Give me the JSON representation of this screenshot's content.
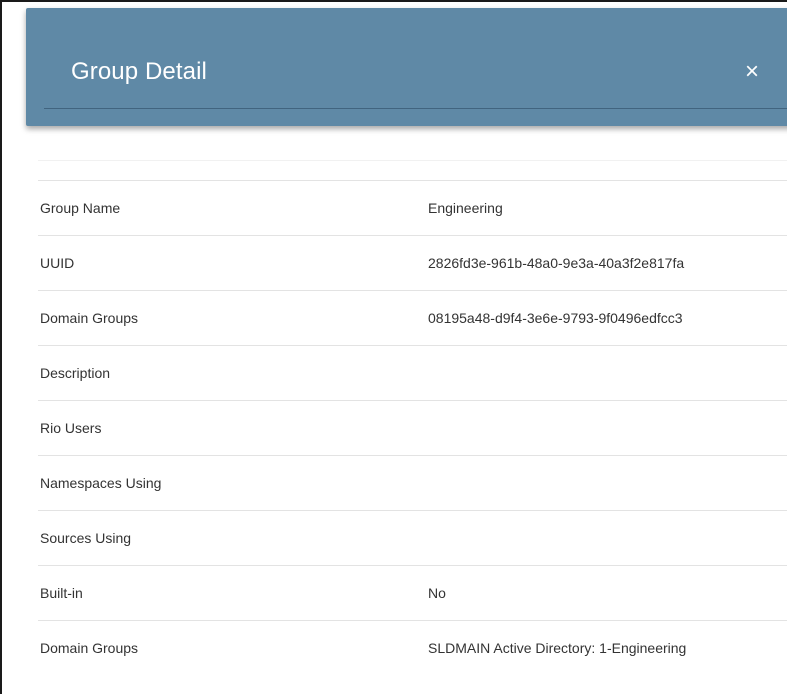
{
  "dialog": {
    "title": "Group Detail",
    "close_icon": "×"
  },
  "details": {
    "rows": [
      {
        "label": "Group Name",
        "value": "Engineering"
      },
      {
        "label": "UUID",
        "value": "2826fd3e-961b-48a0-9e3a-40a3f2e817fa"
      },
      {
        "label": "Domain Groups",
        "value": "08195a48-d9f4-3e6e-9793-9f0496edfcc3"
      },
      {
        "label": "Description",
        "value": ""
      },
      {
        "label": "Rio Users",
        "value": ""
      },
      {
        "label": "Namespaces Using",
        "value": ""
      },
      {
        "label": "Sources Using",
        "value": ""
      },
      {
        "label": "Built-in",
        "value": "No"
      },
      {
        "label": "Domain Groups",
        "value": "SLDMAIN Active Directory: 1-Engineering"
      }
    ]
  },
  "colors": {
    "header_bg": "#5f89a6",
    "text": "#333333",
    "row_border": "#e3e3e3"
  }
}
